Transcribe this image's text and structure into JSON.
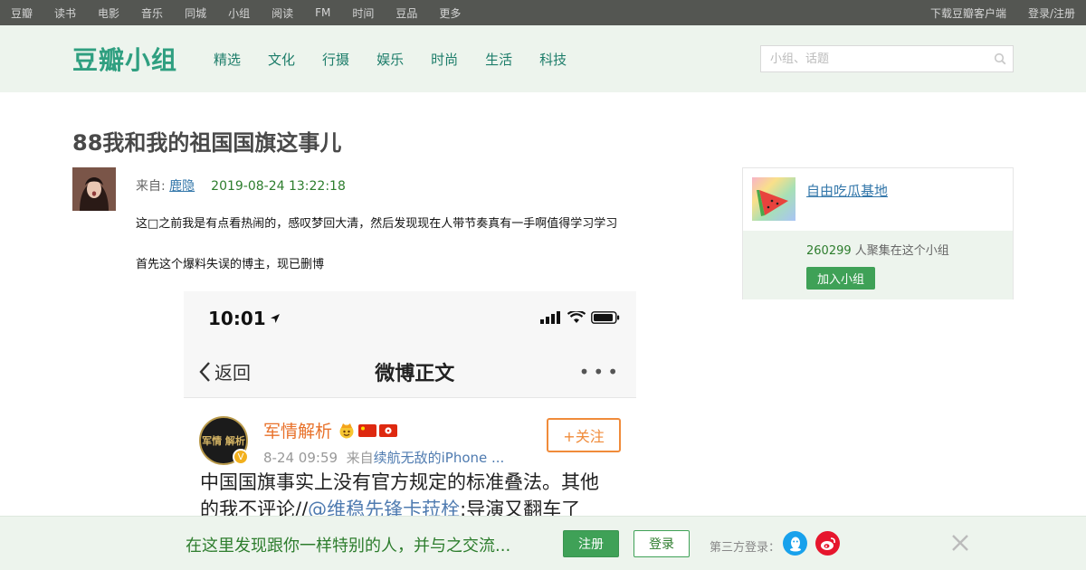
{
  "global_nav": {
    "items": [
      "豆瓣",
      "读书",
      "电影",
      "音乐",
      "同城",
      "小组",
      "阅读",
      "FM",
      "时间",
      "豆品",
      "更多"
    ],
    "download": "下载豆瓣客户端",
    "login_register": "登录/注册"
  },
  "header": {
    "brand": "豆瓣小组",
    "tabs": [
      "精选",
      "文化",
      "行摄",
      "娱乐",
      "时尚",
      "生活",
      "科技"
    ],
    "search_placeholder": "小组、话题"
  },
  "topic": {
    "title": "88我和我的祖国国旗这事儿",
    "from_label": "来自: ",
    "author": "鹿隐",
    "datetime": "2019-08-24 13:22:18",
    "paragraphs": [
      "这□之前我是有点看热闹的，感叹梦回大清，然后发现现在人带节奏真有一手啊值得学习学习",
      "首先这个爆料失误的博主，现已删博"
    ]
  },
  "embedded_screenshot": {
    "status_time": "10:01",
    "back_label": "返回",
    "page_title": "微博正文",
    "more": "•••",
    "avatar_text": "军情 解析",
    "user_name": "军情解析",
    "post_date": "8-24 09:59",
    "source_prefix": "来自",
    "source": "续航无敌的iPhone ...",
    "follow_label": "+关注",
    "text_line1": "中国国旗事实上没有官方规定的标准叠法。其他",
    "text_line2_prefix": "的我不评论//",
    "text_line2_mention": "@维稳先锋卡菈栓",
    "text_line2_suffix": ":导演又翻车了"
  },
  "group_card": {
    "name": "自由吃瓜基地",
    "member_count": "260299",
    "member_suffix": " 人聚集在这个小组",
    "join_label": "加入小组"
  },
  "banner": {
    "slogan": "在这里发现跟你一样特别的人，并与之交流...",
    "register": "注册",
    "login": "登录",
    "third_party": "第三方登录："
  },
  "colors": {
    "brand_green": "#2f9f80",
    "link_blue": "#3377aa",
    "button_green": "#3fa157",
    "header_bg": "#edf4ed",
    "topbar_bg": "#545652"
  }
}
